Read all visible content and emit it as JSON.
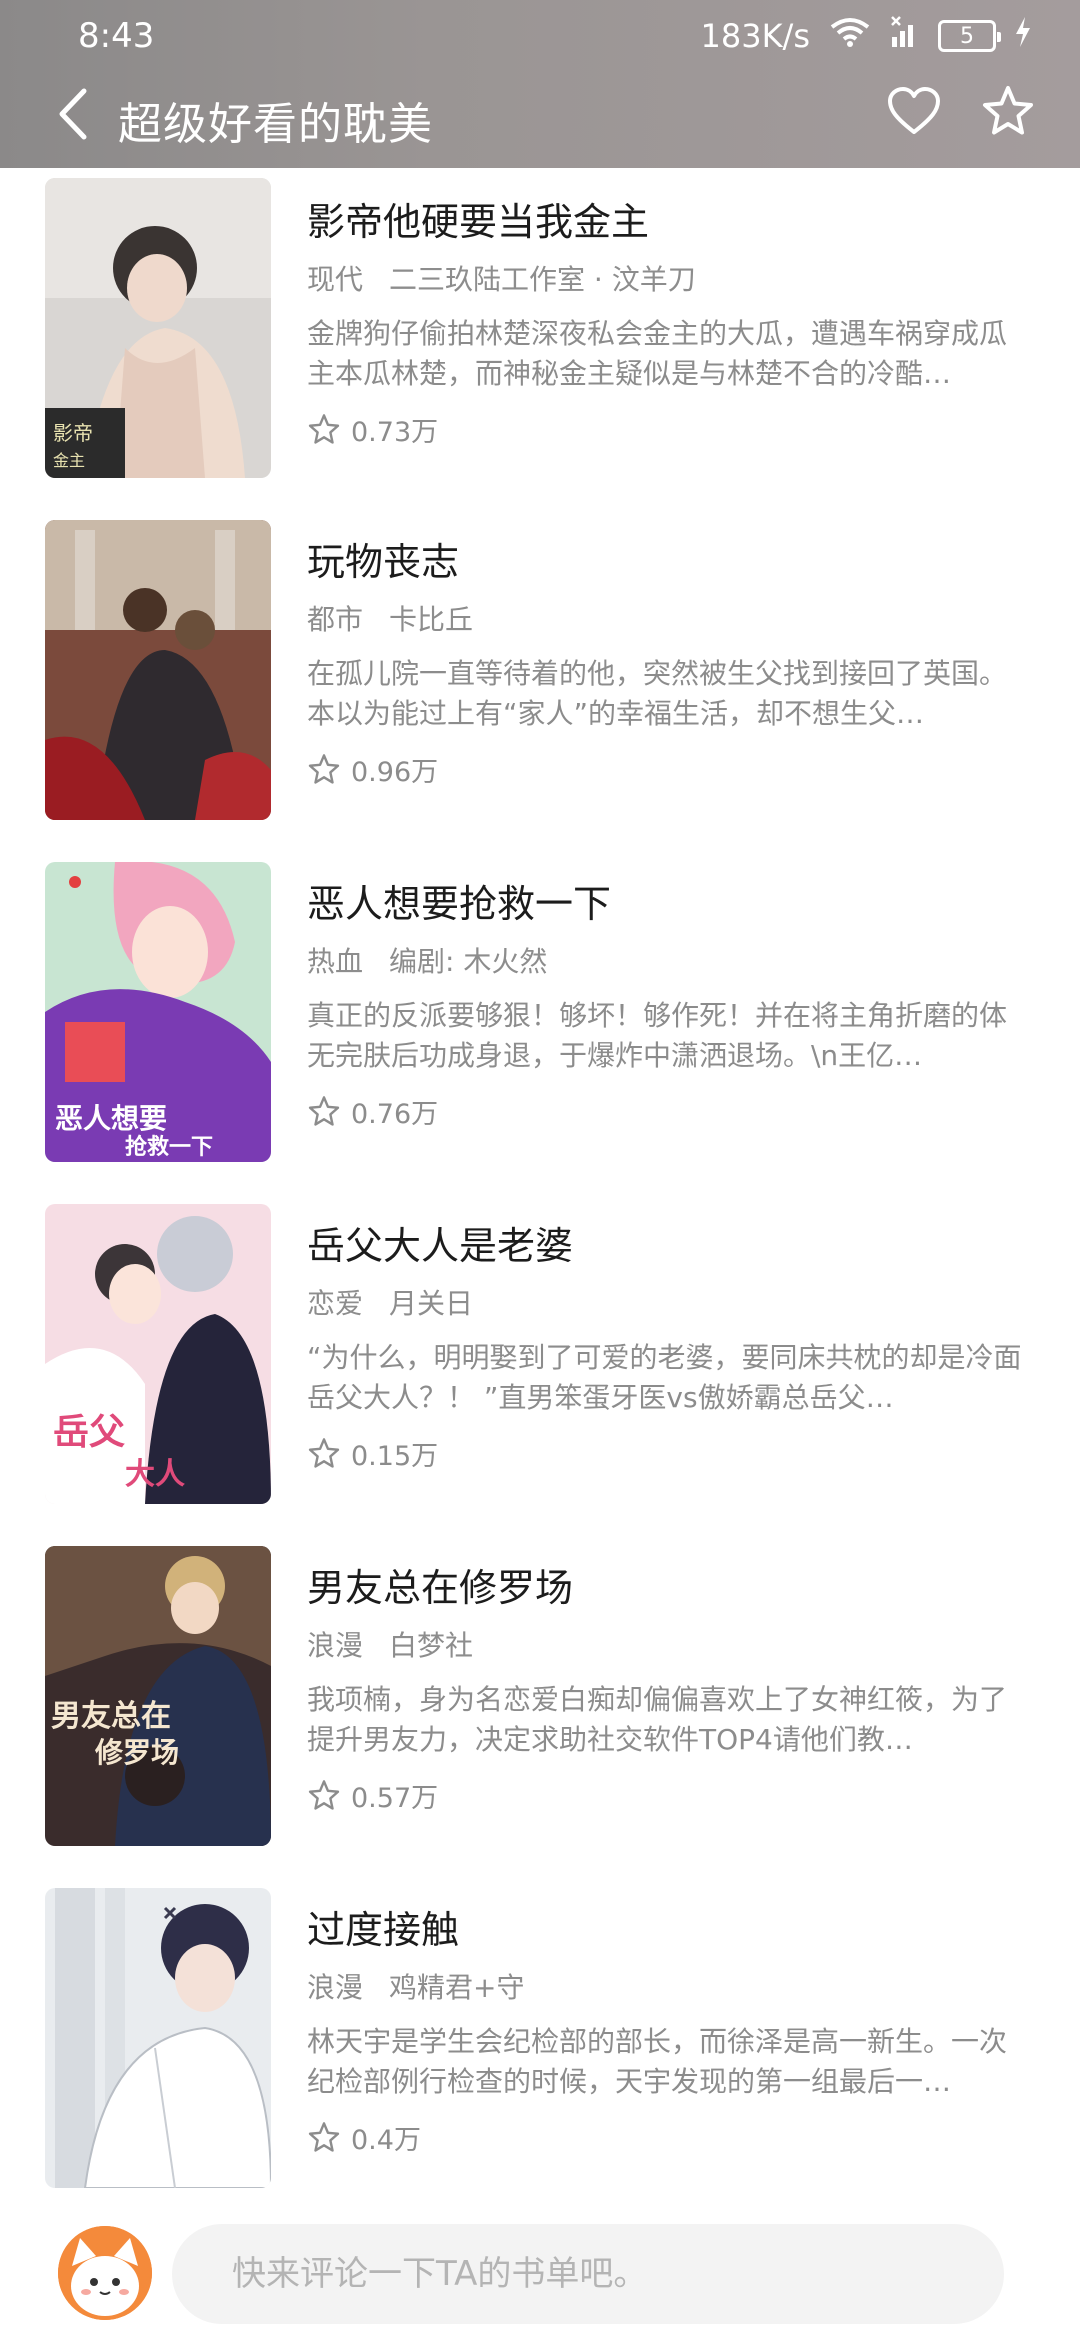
{
  "status_bar": {
    "time": "8:43",
    "net_speed": "183K/s",
    "battery": "5"
  },
  "header": {
    "title": "超级好看的耽美"
  },
  "books": [
    {
      "title": "影帝他硬要当我金主",
      "genre": "现代",
      "author": "二三玖陆工作室 · 汶羊刀",
      "desc": "金牌狗仔偷拍林楚深夜私会金主的大瓜，遭遇车祸穿成瓜主本瓜林楚，而神秘金主疑似是与林楚不合的冷酷…",
      "rating": "0.73万"
    },
    {
      "title": "玩物丧志",
      "genre": "都市",
      "author": "卡比丘",
      "desc": "在孤儿院一直等待着的他，突然被生父找到接回了英国。本以为能过上有“家人”的幸福生活，却不想生父…",
      "rating": "0.96万"
    },
    {
      "title": "恶人想要抢救一下",
      "genre": "热血",
      "author": "编剧: 木火然",
      "desc": "真正的反派要够狠！够坏！够作死！并在将主角折磨的体无完肤后功成身退，于爆炸中潇洒退场。\\n王亿…",
      "rating": "0.76万"
    },
    {
      "title": "岳父大人是老婆",
      "genre": "恋爱",
      "author": "月关日",
      "desc": "“为什么，明明娶到了可爱的老婆，要同床共枕的却是冷面岳父大人？！ ”直男笨蛋牙医vs傲娇霸总岳父…",
      "rating": "0.15万"
    },
    {
      "title": "男友总在修罗场",
      "genre": "浪漫",
      "author": "白梦社",
      "desc": "我项楠，身为名恋爱白痴却偏偏喜欢上了女神红筱，为了提升男友力，决定求助社交软件TOP4请他们教…",
      "rating": "0.57万"
    },
    {
      "title": "过度接触",
      "genre": "浪漫",
      "author": "鸡精君+守",
      "desc": "林天宇是学生会纪检部的部长，而徐泽是高一新生。一次纪检部例行检查的时候，天宇发现的第一组最后一…",
      "rating": "0.4万"
    }
  ],
  "comment": {
    "placeholder": "快来评论一下TA的书单吧。"
  }
}
